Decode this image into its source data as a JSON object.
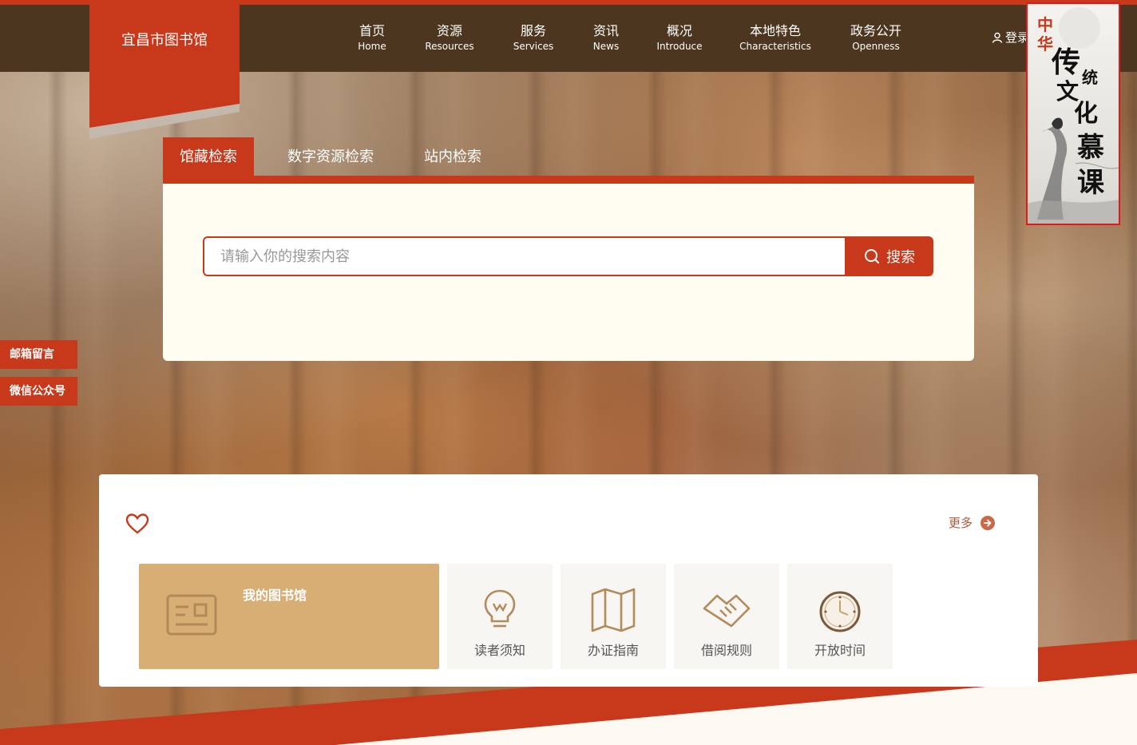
{
  "site": {
    "logo_text": "宜昌市图书馆"
  },
  "nav": [
    {
      "cn": "首页",
      "en": "Home"
    },
    {
      "cn": "资源",
      "en": "Resources"
    },
    {
      "cn": "服务",
      "en": "Services"
    },
    {
      "cn": "资讯",
      "en": "News"
    },
    {
      "cn": "概况",
      "en": "Introduce"
    },
    {
      "cn": "本地特色",
      "en": "Characteristics"
    },
    {
      "cn": "政务公开",
      "en": "Openness"
    }
  ],
  "login": {
    "label": "登录"
  },
  "promo": {
    "chars": [
      "中",
      "华",
      "传",
      "统",
      "文",
      "化",
      "慕",
      "课"
    ]
  },
  "side_tabs": [
    "邮箱留言",
    "微信公众号"
  ],
  "search": {
    "tabs": [
      "馆藏检索",
      "数字资源检索",
      "站内检索"
    ],
    "active_tab": 0,
    "placeholder": "请输入你的搜索内容",
    "value": "",
    "button_label": "搜索"
  },
  "services": {
    "more_label": "更多",
    "featured": {
      "title": "我的图书馆"
    },
    "items": [
      {
        "label": "读者须知",
        "icon": "lightbulb-icon"
      },
      {
        "label": "办证指南",
        "icon": "map-icon"
      },
      {
        "label": "借阅规则",
        "icon": "handshake-icon"
      },
      {
        "label": "开放时间",
        "icon": "clock-icon"
      }
    ]
  },
  "colors": {
    "brand_red": "#c8391c",
    "header_brown": "#4d3620",
    "card_tan": "#d9ae75"
  }
}
